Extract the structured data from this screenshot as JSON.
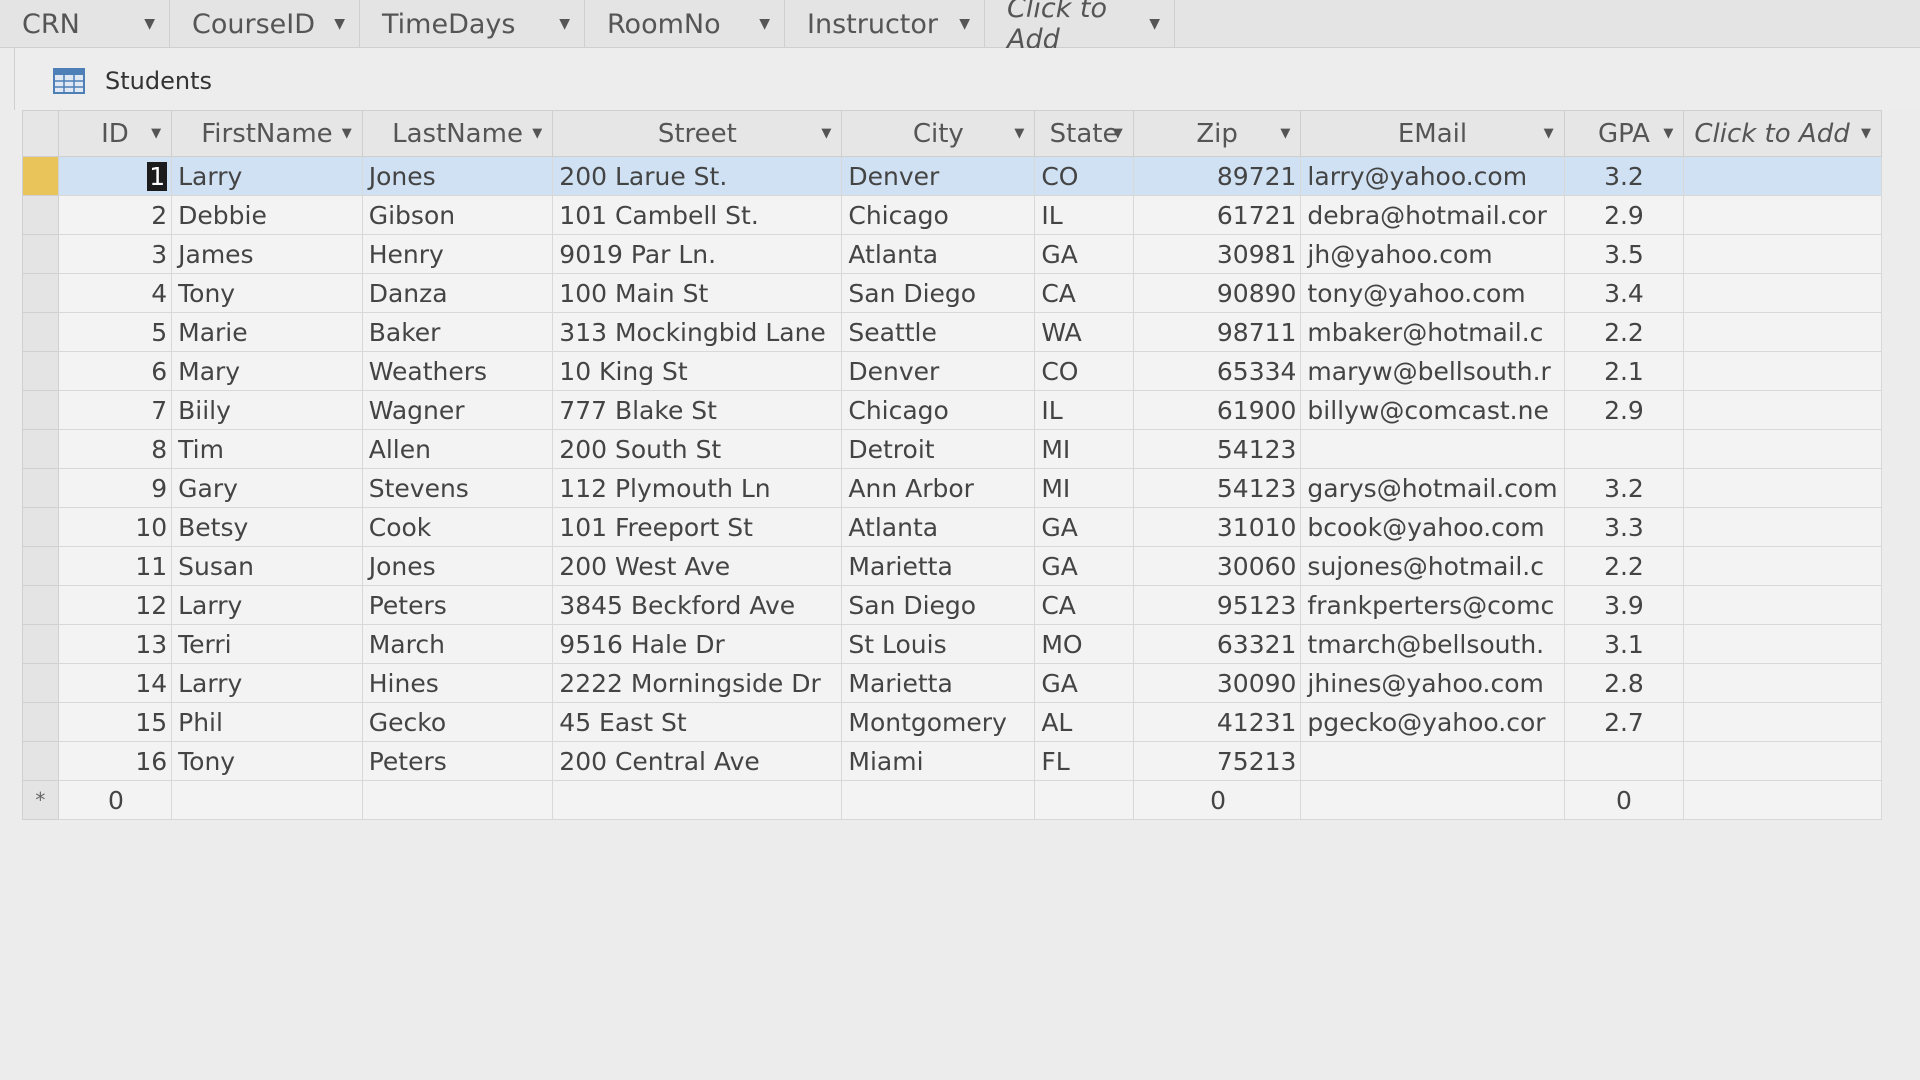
{
  "background_table": {
    "columns": [
      "CRN",
      "CourseID",
      "TimeDays",
      "RoomNo",
      "Instructor",
      "Click to Add"
    ]
  },
  "tab": {
    "title": "Students",
    "icon": "table-icon"
  },
  "students": {
    "columns": [
      "ID",
      "FirstName",
      "LastName",
      "Street",
      "City",
      "State",
      "Zip",
      "EMail",
      "GPA",
      "Click to Add"
    ],
    "rows": [
      {
        "id": "1",
        "first": "Larry",
        "last": "Jones",
        "street": "200 Larue St.",
        "city": "Denver",
        "state": "CO",
        "zip": "89721",
        "email": "larry@yahoo.com",
        "gpa": "3.2"
      },
      {
        "id": "2",
        "first": "Debbie",
        "last": "Gibson",
        "street": "101 Cambell St.",
        "city": "Chicago",
        "state": "IL",
        "zip": "61721",
        "email": "debra@hotmail.cor",
        "gpa": "2.9"
      },
      {
        "id": "3",
        "first": "James",
        "last": "Henry",
        "street": "9019 Par Ln.",
        "city": "Atlanta",
        "state": "GA",
        "zip": "30981",
        "email": "jh@yahoo.com",
        "gpa": "3.5"
      },
      {
        "id": "4",
        "first": "Tony",
        "last": "Danza",
        "street": "100 Main St",
        "city": "San Diego",
        "state": "CA",
        "zip": "90890",
        "email": "tony@yahoo.com",
        "gpa": "3.4"
      },
      {
        "id": "5",
        "first": "Marie",
        "last": "Baker",
        "street": "313 Mockingbid Lane",
        "city": "Seattle",
        "state": "WA",
        "zip": "98711",
        "email": "mbaker@hotmail.c",
        "gpa": "2.2"
      },
      {
        "id": "6",
        "first": "Mary",
        "last": "Weathers",
        "street": "10 King St",
        "city": "Denver",
        "state": "CO",
        "zip": "65334",
        "email": "maryw@bellsouth.r",
        "gpa": "2.1"
      },
      {
        "id": "7",
        "first": "Biily",
        "last": "Wagner",
        "street": "777 Blake St",
        "city": "Chicago",
        "state": "IL",
        "zip": "61900",
        "email": "billyw@comcast.ne",
        "gpa": "2.9"
      },
      {
        "id": "8",
        "first": "Tim",
        "last": "Allen",
        "street": "200 South St",
        "city": "Detroit",
        "state": "MI",
        "zip": "54123",
        "email": "",
        "gpa": ""
      },
      {
        "id": "9",
        "first": "Gary",
        "last": "Stevens",
        "street": "112 Plymouth Ln",
        "city": "Ann Arbor",
        "state": "MI",
        "zip": "54123",
        "email": "garys@hotmail.com",
        "gpa": "3.2"
      },
      {
        "id": "10",
        "first": "Betsy",
        "last": "Cook",
        "street": "101 Freeport St",
        "city": "Atlanta",
        "state": "GA",
        "zip": "31010",
        "email": "bcook@yahoo.com",
        "gpa": "3.3"
      },
      {
        "id": "11",
        "first": "Susan",
        "last": "Jones",
        "street": "200 West Ave",
        "city": "Marietta",
        "state": "GA",
        "zip": "30060",
        "email": "sujones@hotmail.c",
        "gpa": "2.2"
      },
      {
        "id": "12",
        "first": "Larry",
        "last": "Peters",
        "street": "3845 Beckford Ave",
        "city": "San Diego",
        "state": "CA",
        "zip": "95123",
        "email": "frankperters@comc",
        "gpa": "3.9"
      },
      {
        "id": "13",
        "first": "Terri",
        "last": "March",
        "street": "9516 Hale Dr",
        "city": "St Louis",
        "state": "MO",
        "zip": "63321",
        "email": "tmarch@bellsouth.",
        "gpa": "3.1"
      },
      {
        "id": "14",
        "first": "Larry",
        "last": "Hines",
        "street": "2222 Morningside Dr",
        "city": "Marietta",
        "state": "GA",
        "zip": "30090",
        "email": "jhines@yahoo.com",
        "gpa": "2.8"
      },
      {
        "id": "15",
        "first": "Phil",
        "last": "Gecko",
        "street": "45 East St",
        "city": "Montgomery",
        "state": "AL",
        "zip": "41231",
        "email": "pgecko@yahoo.cor",
        "gpa": "2.7"
      },
      {
        "id": "16",
        "first": "Tony",
        "last": "Peters",
        "street": "200 Central Ave",
        "city": "Miami",
        "state": "FL",
        "zip": "75213",
        "email": "",
        "gpa": ""
      }
    ],
    "new_row": {
      "marker": "*",
      "id": "0",
      "zip": "0",
      "gpa": "0"
    }
  },
  "colors": {
    "current_row": "#cfe1f2",
    "record_selector": "#e8c45a"
  }
}
